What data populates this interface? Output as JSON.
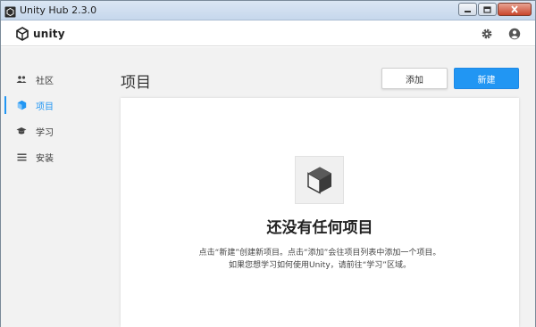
{
  "window": {
    "title": "Unity Hub 2.3.0",
    "icons": [
      "unity-hub-app-icon",
      "minimize-icon",
      "maximize-icon",
      "close-icon"
    ]
  },
  "header": {
    "logo_text": "unity",
    "icons": [
      "unity-logo-icon",
      "gear-icon",
      "account-icon"
    ]
  },
  "sidebar": {
    "items": [
      {
        "label": "社区",
        "icon": "people-icon",
        "active": false
      },
      {
        "label": "项目",
        "icon": "cube-icon",
        "active": true
      },
      {
        "label": "学习",
        "icon": "graduation-cap-icon",
        "active": false
      },
      {
        "label": "安装",
        "icon": "list-icon",
        "active": false
      }
    ]
  },
  "main": {
    "title": "项目",
    "add_button": "添加",
    "new_button": "新建",
    "empty_state": {
      "icon": "cube-icon",
      "title": "还没有任何项目",
      "line1": "点击“新建”创建新项目。点击“添加”会往项目列表中添加一个项目。",
      "line2": "如果您想学习如何使用Unity，请前往“学习”区域。"
    }
  },
  "colors": {
    "accent": "#2196f3",
    "sidebar_bg": "#f2f2f2",
    "text": "#333333"
  }
}
